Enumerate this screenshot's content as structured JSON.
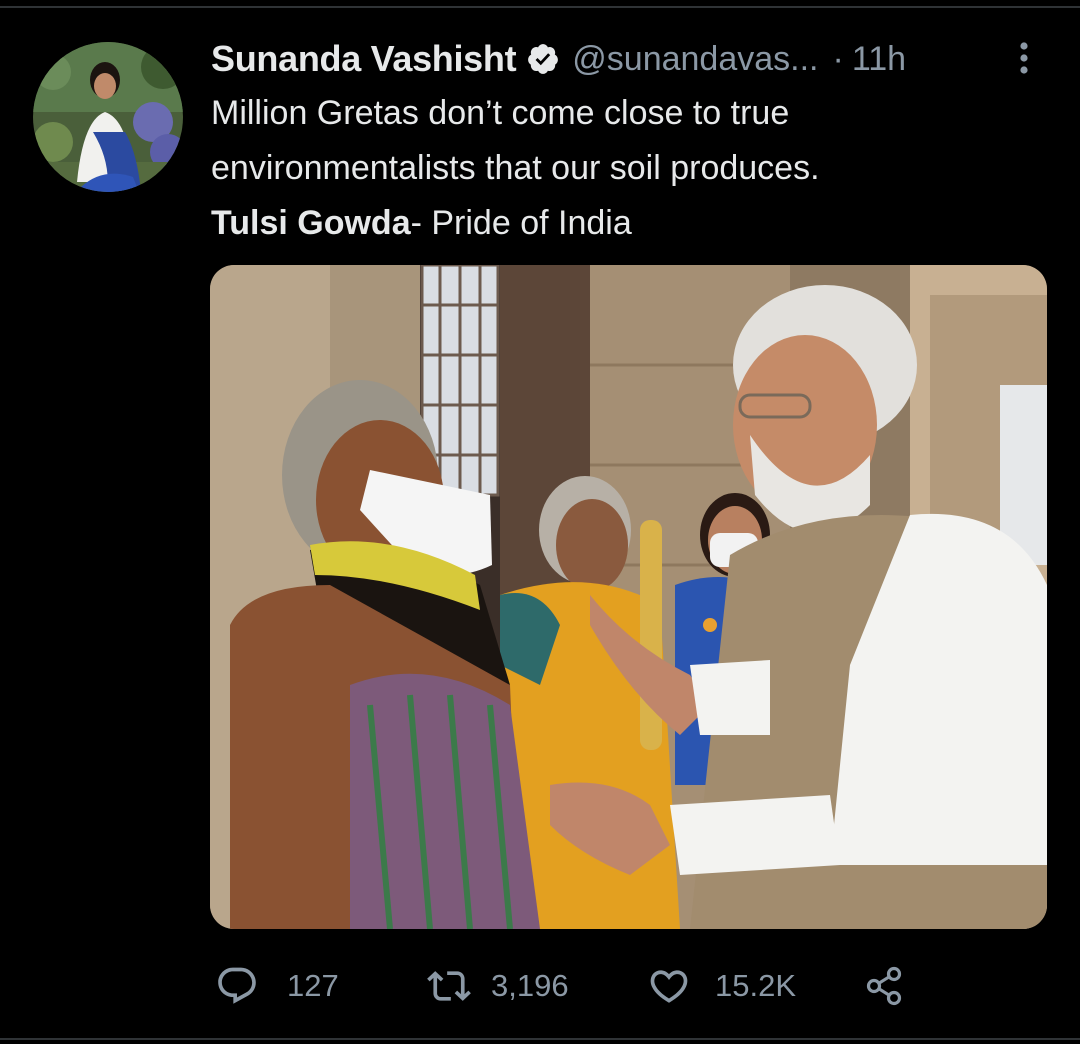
{
  "tweet": {
    "display_name": "Sunanda Vashisht",
    "handle": "@sunandavas...",
    "separator": "·",
    "time": "11h",
    "text_lines": [
      "Million Gretas don’t come close to true",
      "environmentalists that our soil produces."
    ],
    "text_bold": "Tulsi Gowda",
    "text_tail": "- Pride of India"
  },
  "actions": {
    "reply_count": "127",
    "retweet_count": "3,196",
    "like_count": "15.2K"
  },
  "icons": {
    "verified": "verified-badge-icon",
    "more": "more-vertical-icon",
    "reply": "comment-bubble-icon",
    "retweet": "retweet-arrows-icon",
    "like": "heart-outline-icon",
    "share": "share-nodes-icon"
  },
  "colors": {
    "background": "#000000",
    "text_primary": "#e7e9ea",
    "text_secondary": "#8b98a5",
    "divider": "#2f3336"
  }
}
